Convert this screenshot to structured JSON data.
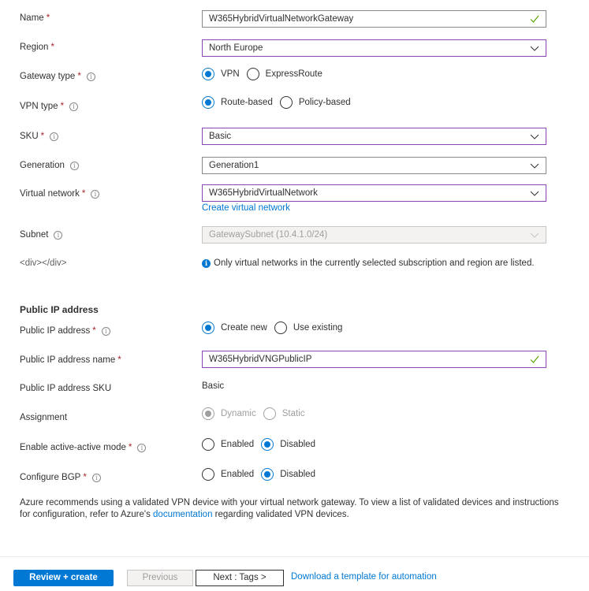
{
  "fields": {
    "name": {
      "label": "Name",
      "required": "*",
      "value": "W365HybridVirtualNetworkGateway",
      "valid_icon": "checkmark-icon"
    },
    "region": {
      "label": "Region",
      "required": "*",
      "value": "North Europe"
    },
    "gateway_type": {
      "label": "Gateway type",
      "required": "*",
      "info": "i",
      "options": [
        "VPN",
        "ExpressRoute"
      ],
      "selected": "VPN"
    },
    "vpn_type": {
      "label": "VPN type",
      "required": "*",
      "info": "i",
      "options": [
        "Route-based",
        "Policy-based"
      ],
      "selected": "Route-based"
    },
    "sku": {
      "label": "SKU",
      "required": "*",
      "info": "i",
      "value": "Basic"
    },
    "generation": {
      "label": "Generation",
      "info": "i",
      "value": "Generation1"
    },
    "virtual_network": {
      "label": "Virtual network",
      "required": "*",
      "info": "i",
      "value": "W365HybridVirtualNetwork",
      "link": "Create virtual network"
    },
    "subnet": {
      "label": "Subnet",
      "info": "i",
      "value": "GatewaySubnet (10.4.1.0/24)"
    },
    "div_label": {
      "label": "<div></div>",
      "note_icon": "i",
      "note": "Only virtual networks in the currently selected subscription and region are listed."
    }
  },
  "public_ip": {
    "section_title": "Public IP address",
    "address": {
      "label": "Public IP address",
      "required": "*",
      "info": "i",
      "options": [
        "Create new",
        "Use existing"
      ],
      "selected": "Create new"
    },
    "name": {
      "label": "Public IP address name",
      "required": "*",
      "value": "W365HybridVNGPublicIP"
    },
    "sku": {
      "label": "Public IP address SKU",
      "value": "Basic"
    },
    "assignment": {
      "label": "Assignment",
      "options": [
        "Dynamic",
        "Static"
      ],
      "selected": "Dynamic"
    },
    "active_active": {
      "label": "Enable active-active mode",
      "required": "*",
      "info": "i",
      "options": [
        "Enabled",
        "Disabled"
      ],
      "selected": "Disabled"
    },
    "bgp": {
      "label": "Configure BGP",
      "required": "*",
      "info": "i",
      "options": [
        "Enabled",
        "Disabled"
      ],
      "selected": "Disabled"
    }
  },
  "recommendation": {
    "before": "Azure recommends using a validated VPN device with your virtual network gateway. To view a list of validated devices and instructions for configuration, refer to Azure's ",
    "link": "documentation",
    "after": " regarding validated VPN devices."
  },
  "footer": {
    "review_create": "Review + create",
    "previous": "Previous",
    "next": "Next : Tags >",
    "download_link": "Download a template for automation"
  },
  "colors": {
    "accent": "#0078d4",
    "focus_border": "#8c44b4",
    "required": "#a4262c",
    "valid": "#57a300"
  }
}
